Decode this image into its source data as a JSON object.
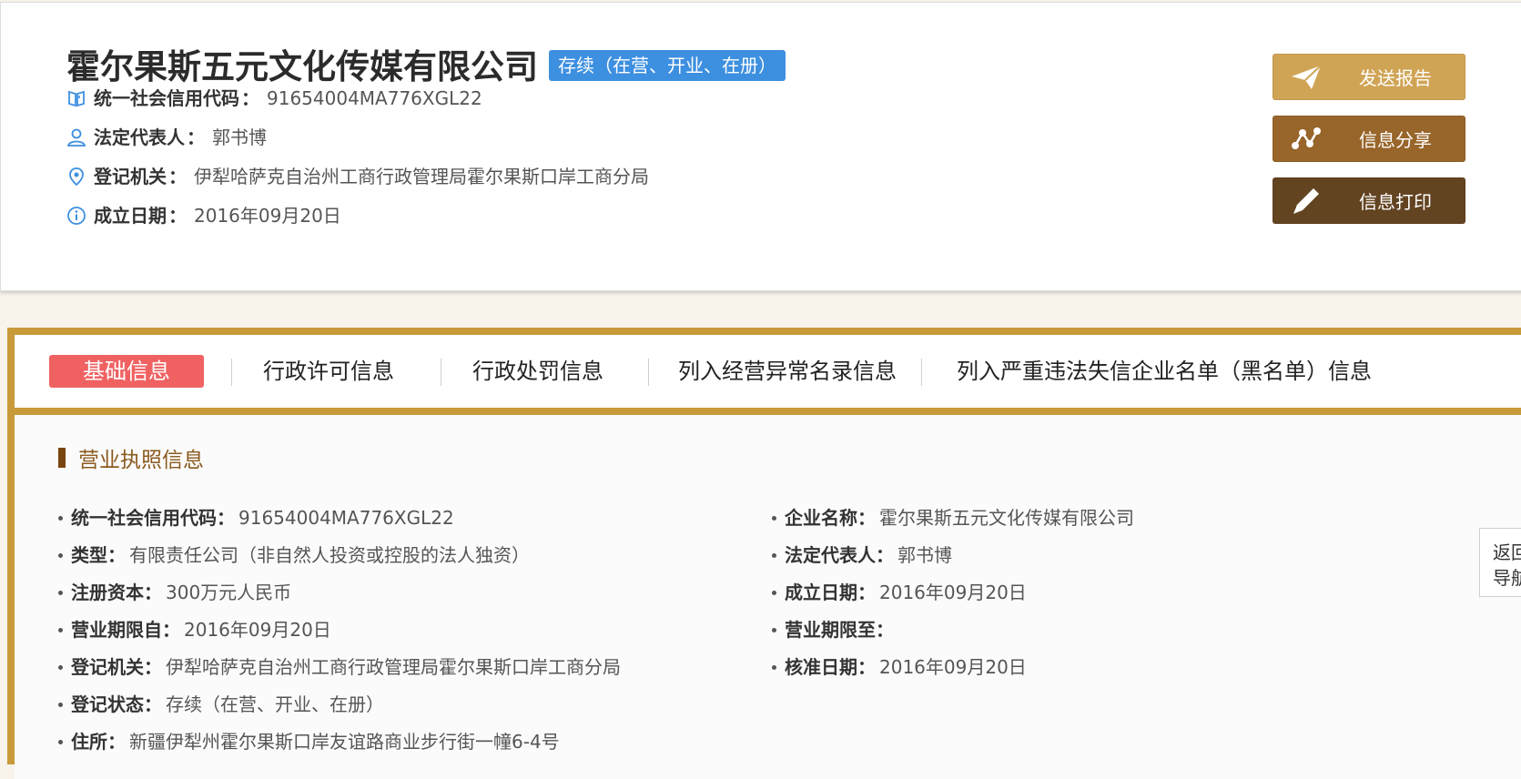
{
  "company": {
    "name": "霍尔果斯五元文化传媒有限公司",
    "status_badge": "存续（在营、开业、在册）"
  },
  "summary": [
    {
      "icon": "book-icon",
      "label": "统一社会信用代码",
      "colon": "：",
      "value": "91654004MA776XGL22"
    },
    {
      "icon": "person-icon",
      "label": "法定代表人",
      "colon": "：",
      "value": "郭书博"
    },
    {
      "icon": "location-pin-icon",
      "label": "登记机关",
      "colon": "：",
      "value": "伊犁哈萨克自治州工商行政管理局霍尔果斯口岸工商分局"
    },
    {
      "icon": "info-icon",
      "label": "成立日期",
      "colon": "：",
      "value": "2016年09月20日"
    }
  ],
  "actions": {
    "send_report": "发送报告",
    "share_info": "信息分享",
    "print_info": "信息打印"
  },
  "tabs": [
    {
      "label": "基础信息",
      "active": true
    },
    {
      "label": "行政许可信息",
      "active": false
    },
    {
      "label": "行政处罚信息",
      "active": false
    },
    {
      "label": "列入经营异常名录信息",
      "active": false
    },
    {
      "label": "列入严重违法失信企业名单（黑名单）信息",
      "active": false
    }
  ],
  "section": {
    "title": "营业执照信息"
  },
  "left_fields": [
    {
      "label": "统一社会信用代码",
      "colon": "：",
      "value": "91654004MA776XGL22"
    },
    {
      "label": "类型",
      "colon": "：",
      "value": "有限责任公司（非自然人投资或控股的法人独资）"
    },
    {
      "label": "注册资本",
      "colon": "：",
      "value": "300万元人民币"
    },
    {
      "label": "营业期限自",
      "colon": "：",
      "value": "2016年09月20日"
    },
    {
      "label": "登记机关",
      "colon": "：",
      "value": "伊犁哈萨克自治州工商行政管理局霍尔果斯口岸工商分局"
    },
    {
      "label": "登记状态",
      "colon": "：",
      "value": "存续（在营、开业、在册）"
    },
    {
      "label": "住所",
      "colon": "：",
      "value": "新疆伊犁州霍尔果斯口岸友谊路商业步行街一幢6-4号"
    }
  ],
  "right_fields": [
    {
      "label": "企业名称",
      "colon": "：",
      "value": "霍尔果斯五元文化传媒有限公司"
    },
    {
      "label": "法定代表人",
      "colon": "：",
      "value": "郭书博"
    },
    {
      "label": "成立日期",
      "colon": "：",
      "value": "2016年09月20日"
    },
    {
      "label": "营业期限至",
      "colon": "：",
      "value": ""
    },
    {
      "label": "核准日期",
      "colon": "：",
      "value": "2016年09月20日"
    }
  ],
  "side_nav": {
    "line1": "返回",
    "line2": "导航"
  },
  "colors": {
    "status_badge": "#3d8fe0",
    "send_button": "#d0a455",
    "share_button": "#98652a",
    "print_button": "#634421",
    "panel_border": "#c99a3a",
    "active_tab": "#f06262",
    "section_title": "#8a5a1e"
  }
}
